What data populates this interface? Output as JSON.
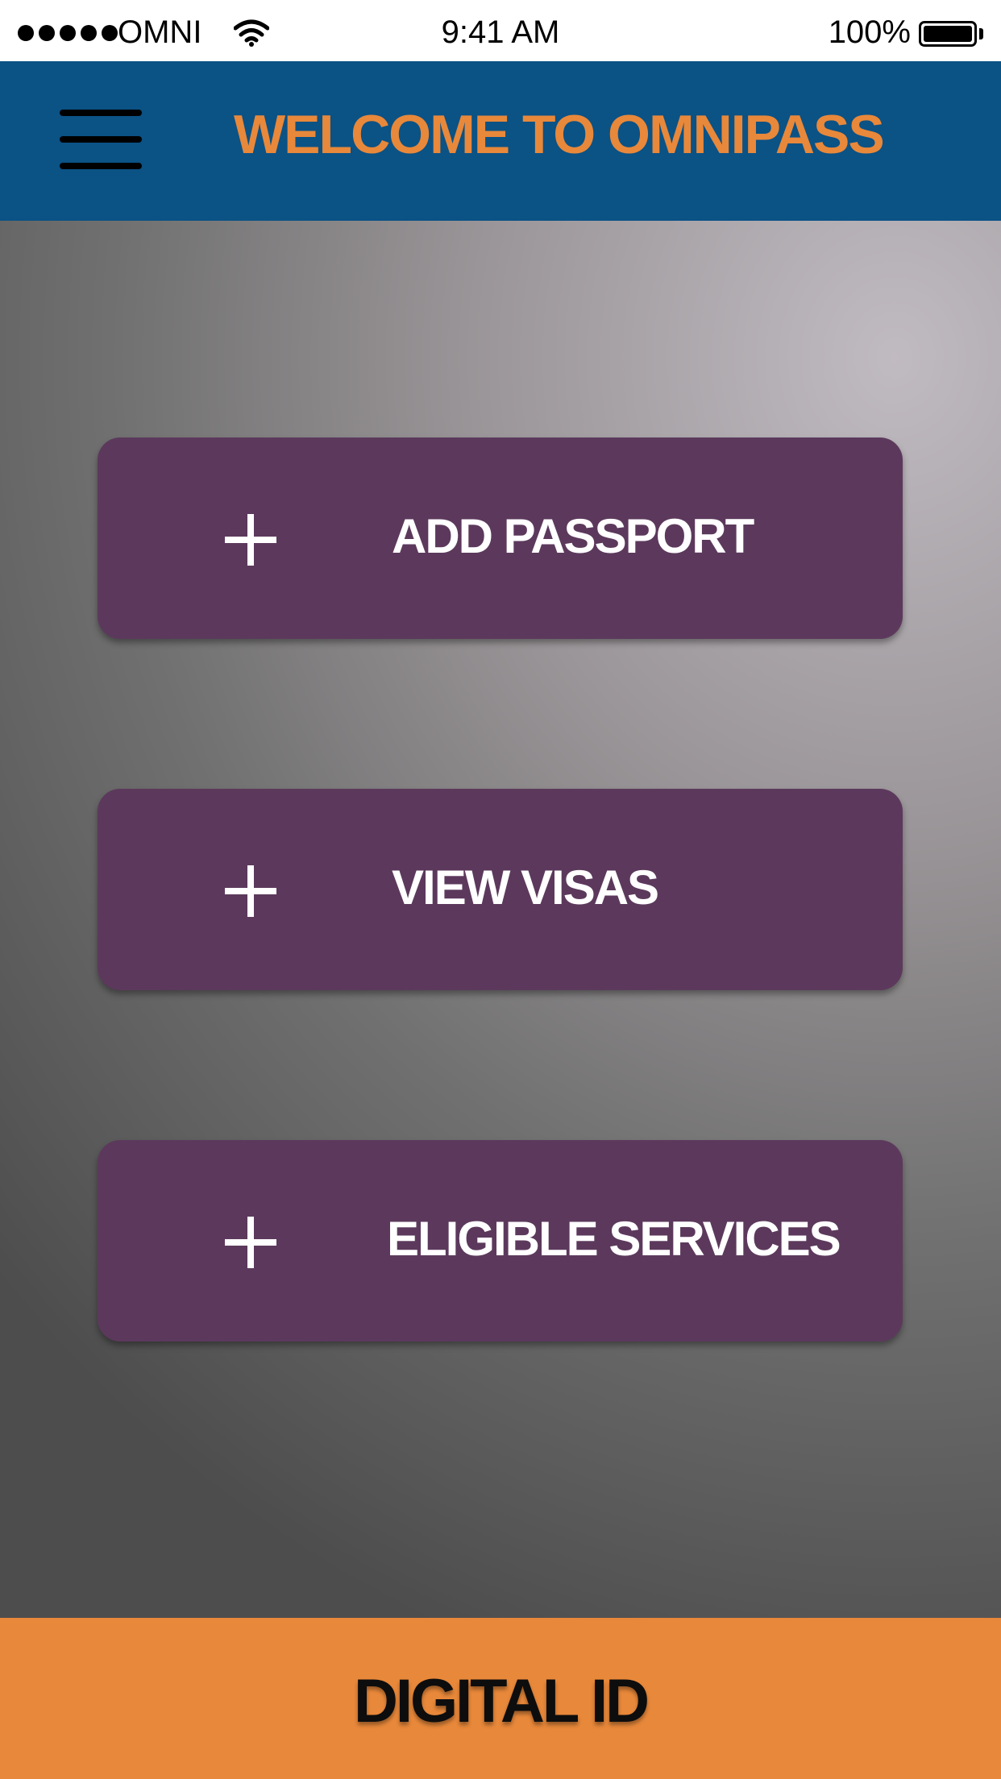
{
  "status_bar": {
    "carrier": "OMNI",
    "time": "9:41 AM",
    "battery_percent": "100%",
    "signal_bars": 5,
    "battery_level": 1.0,
    "icons": [
      "signal-dots-icon",
      "wifi-icon",
      "battery-icon"
    ]
  },
  "header": {
    "title": "WELCOME TO OMNIPASS",
    "menu_icon": "hamburger-menu-icon",
    "background_color": "#0b5285",
    "title_color": "#e8883a"
  },
  "actions": [
    {
      "label": "ADD PASSPORT",
      "icon": "plus-icon"
    },
    {
      "label": "VIEW VISAS",
      "icon": "plus-icon"
    },
    {
      "label": "ELIGIBLE SERVICES",
      "icon": "plus-icon"
    }
  ],
  "action_button_color": "#5c395c",
  "footer": {
    "label": "DIGITAL ID",
    "background_color": "#e8883a"
  }
}
